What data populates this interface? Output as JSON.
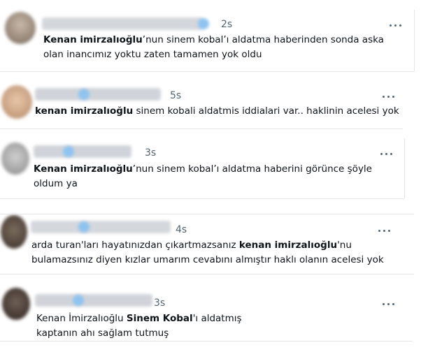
{
  "tweets": [
    {
      "time": "2s",
      "line1_bold": "Kenan imirzalıoğlu",
      "line1_rest": "’nun sinem kobal’ı aldatma haberinden sonda aska",
      "line2": "olan inancımız yoktu zaten tamamen yok oldu"
    },
    {
      "time": "5s",
      "line1_bold": "kenan imirzalıoğlu",
      "line1_rest": " sinem kobali aldatmis iddialari var.. haklinin acelesi yok"
    },
    {
      "time": "3s",
      "line1_bold": "Kenan imirzalıoğlu",
      "line1_rest": "’nun sinem kobal’ı aldatma haberini görünce şöyle",
      "line2": "oldum ya"
    },
    {
      "time": "4s",
      "line1_pre": "arda turan'ları hayatınızdan çıkartmazsanız ",
      "line1_bold": "kenan imirzalıoğlu",
      "line1_rest": "'nu",
      "line2": "bulamazsınız diyen kızlar umarım cevabını almıştır haklı olanın acelesi yok"
    },
    {
      "time": "3s",
      "line1_pre": "Kenan İmirzalıoğlu ",
      "line1_bold": "Sinem Kobal",
      "line1_rest": "'ı aldatmış",
      "line2": "kaptanın ahı sağlam tutmuş"
    }
  ]
}
